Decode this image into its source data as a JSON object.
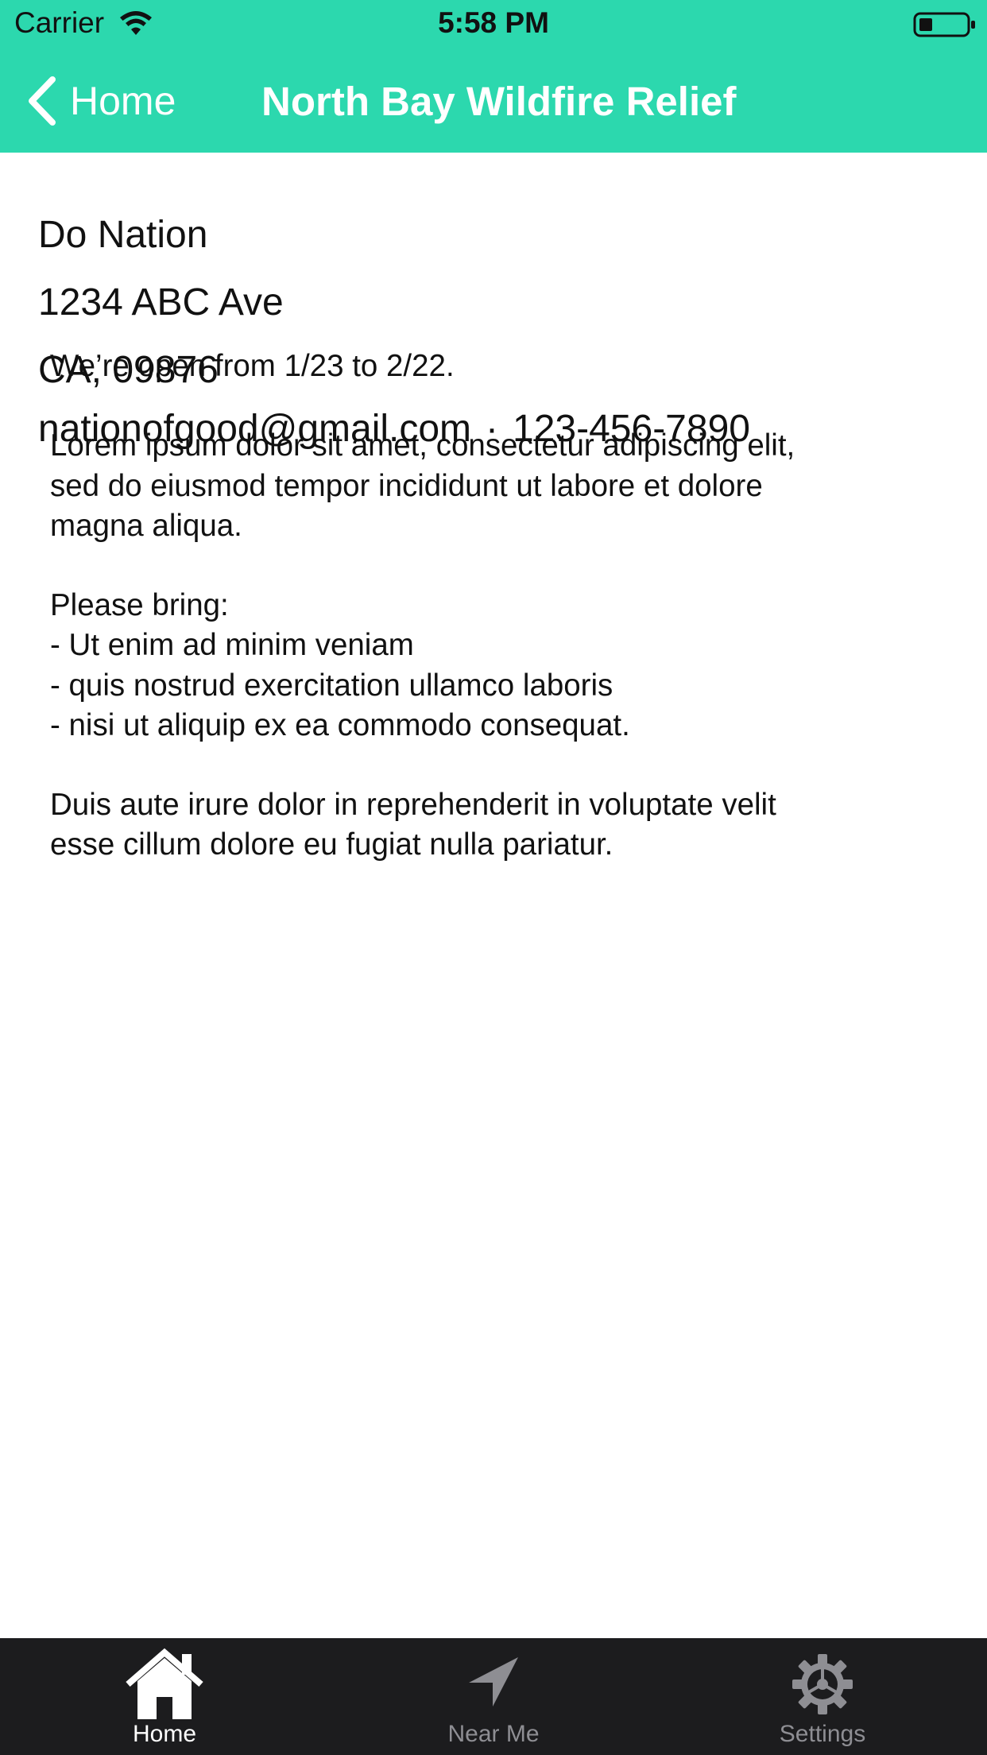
{
  "status_bar": {
    "carrier": "Carrier",
    "time": "5:58 PM",
    "wifi_icon": "wifi-icon",
    "battery_icon": "battery-icon"
  },
  "nav": {
    "back_label": "Home",
    "back_icon": "chevron-left-icon",
    "title": "North Bay Wildfire Relief"
  },
  "organization": {
    "name": "Do Nation",
    "street": "1234 ABC Ave",
    "region": "CA, 09876",
    "email": "nationofgood@gmail.com",
    "separator": "·",
    "phone": "123-456-7890"
  },
  "description": {
    "open_dates": "We’re open from 1/23 to 2/22.",
    "intro_lines": [
      "Lorem ipsum dolor sit amet, consectetur adipiscing elit,",
      "sed do eiusmod tempor incididunt ut labore et dolore",
      "magna aliqua."
    ],
    "bring_heading": "Please bring:",
    "bring_items": [
      "- Ut enim ad minim veniam",
      "- quis nostrud exercitation ullamco laboris",
      "- nisi ut aliquip ex ea commodo consequat."
    ],
    "closing_lines": [
      "Duis aute irure dolor in reprehenderit in voluptate velit",
      "esse cillum dolore eu fugiat nulla pariatur."
    ]
  },
  "tabs": [
    {
      "label": "Home",
      "icon": "home-icon",
      "selected": true
    },
    {
      "label": "Near Me",
      "icon": "location-arrow-icon",
      "selected": false
    },
    {
      "label": "Settings",
      "icon": "gear-icon",
      "selected": false
    }
  ],
  "colors": {
    "header": "#2cd8ae",
    "tab_bar": "#1c1c1e",
    "tab_active": "#ffffff",
    "tab_inactive": "#8e8e93"
  }
}
